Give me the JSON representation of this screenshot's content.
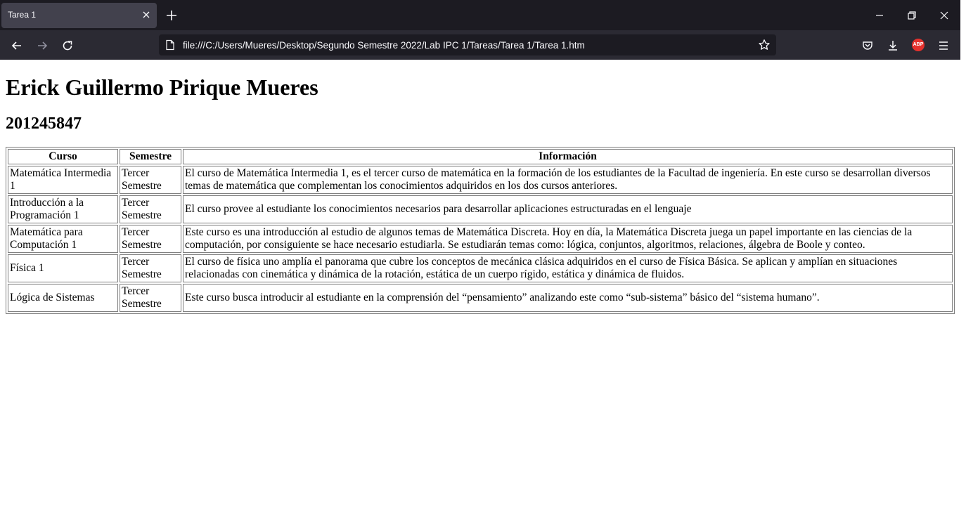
{
  "browser": {
    "tab_title": "Tarea 1",
    "url": "file:///C:/Users/Mueres/Desktop/Segundo Semestre 2022/Lab IPC 1/Tareas/Tarea 1/Tarea 1.htm",
    "extension_label": "ABP"
  },
  "page": {
    "title": "Erick Guillermo Pirique Mueres",
    "subtitle": "201245847",
    "table": {
      "headers": [
        "Curso",
        "Semestre",
        "Información"
      ],
      "rows": [
        {
          "curso": "Matemática Intermedia 1",
          "semestre": "Tercer Semestre",
          "info": "El curso de Matemática Intermedia 1, es el tercer curso de matemática en la formación de los estudiantes de la Facultad de ingeniería. En este curso se desarrollan diversos temas de matemática que complementan los conocimientos adquiridos en los dos cursos anteriores."
        },
        {
          "curso": "Introducción a la Programación 1",
          "semestre": "Tercer Semestre",
          "info": "El curso provee al estudiante los conocimientos necesarios para desarrollar aplicaciones estructuradas en el lenguaje"
        },
        {
          "curso": "Matemática para Computación 1",
          "semestre": "Tercer Semestre",
          "info": "Este curso es una introducción al estudio de algunos temas de Matemática Discreta. Hoy en día, la Matemática Discreta juega un papel importante en las ciencias de la computación, por consiguiente se hace necesario estudiarla. Se estudiarán temas como: lógica, conjuntos, algoritmos, relaciones, álgebra de Boole y conteo."
        },
        {
          "curso": "Física 1",
          "semestre": "Tercer Semestre",
          "info": "El curso de física uno amplía el panorama que cubre los conceptos de mecánica clásica adquiridos en el curso de Física Básica. Se aplican y amplían en situaciones relacionadas con cinemática y dinámica de la rotación, estática de un cuerpo rígido, estática y dinámica de fluidos."
        },
        {
          "curso": "Lógica de Sistemas",
          "semestre": "Tercer Semestre",
          "info": "Este curso busca introducir al estudiante en la comprensión del “pensamiento” analizando este como “sub-sistema” básico del “sistema humano”."
        }
      ]
    }
  }
}
